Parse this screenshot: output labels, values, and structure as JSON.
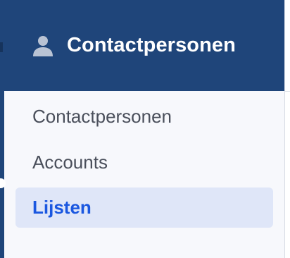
{
  "header": {
    "icon": "user-icon",
    "title": "Contactpersonen"
  },
  "menu": {
    "items": [
      {
        "label": "Contactpersonen",
        "active": false
      },
      {
        "label": "Accounts",
        "active": false
      },
      {
        "label": "Lijsten",
        "active": true
      }
    ]
  },
  "colors": {
    "header_bg": "#1f457a",
    "menu_bg": "#f7f8fc",
    "active_bg": "#dfe6f8",
    "active_text": "#1a57e0",
    "item_text": "#4a4f5b"
  }
}
